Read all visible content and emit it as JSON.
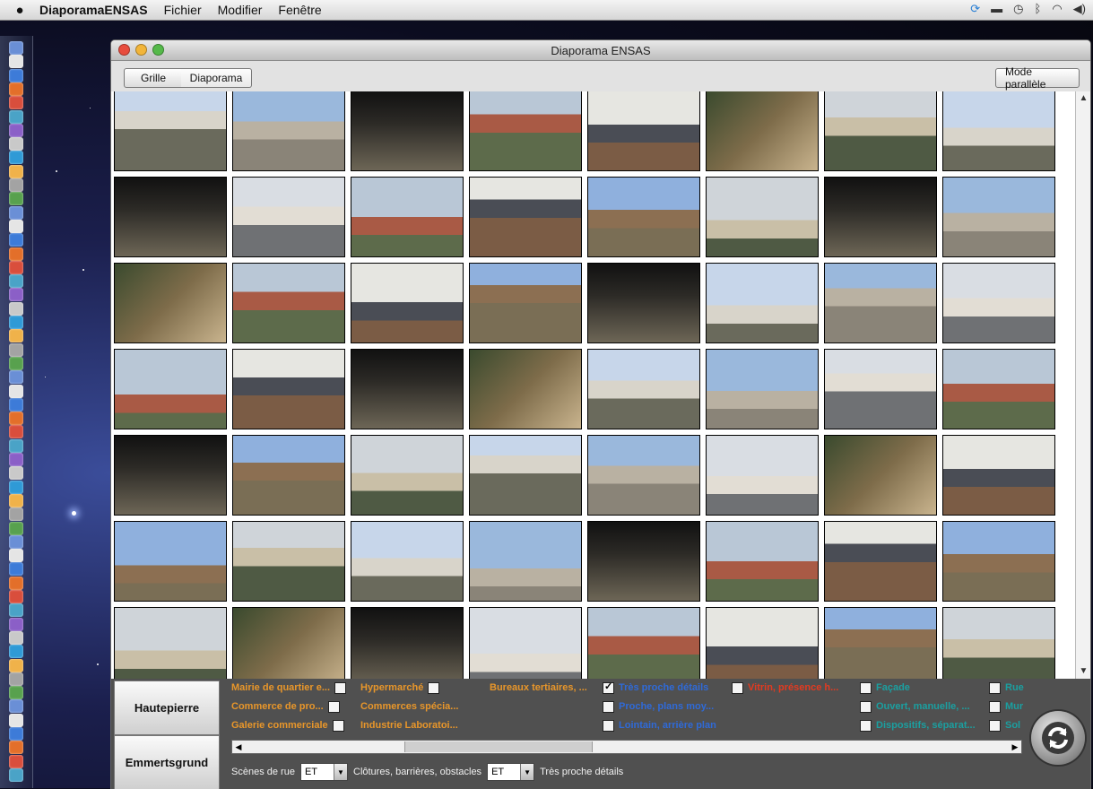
{
  "menubar": {
    "app_name": "DiaporamaENSAS",
    "items": [
      "Fichier",
      "Modifier",
      "Fenêtre"
    ],
    "tray_icons": [
      "sync-icon",
      "display-icon",
      "time-machine-icon",
      "bluetooth-icon",
      "wifi-icon",
      "volume-icon"
    ]
  },
  "window": {
    "title": "Diaporama ENSAS"
  },
  "toolbar": {
    "grid_label": "Grille",
    "slideshow_label": "Diaporama",
    "parallel_label": "Mode parallèle"
  },
  "places": [
    "Hautepierre",
    "Emmertsgrund"
  ],
  "filters": {
    "orange": [
      "Mairie de quartier e...",
      "Hypermarché",
      "Bureaux tertiaires, ...",
      "Commerce de pro...",
      "Commerces spécia...",
      "Galerie commerciale",
      "Industrie Laboratoi..."
    ],
    "blue": [
      "Très proche détails",
      "Proche, plans moy...",
      "Lointain, arrière plan"
    ],
    "red": [
      "Vitrin, présence h..."
    ],
    "teal": [
      "Façade",
      "Ouvert, manuelle, ...",
      "Dispositifs, séparat...",
      "Rue",
      "Mur",
      "Sol"
    ],
    "checked": "Très proche détails"
  },
  "query": {
    "term1": "Scènes de rue",
    "op1": "ET",
    "term2": "Clôtures, barrières, obstacles",
    "op2": "ET",
    "term3": "Très proche détails"
  },
  "colors": {
    "orange": "#e8962a",
    "blue": "#2f6ad8",
    "red": "#e23a20",
    "teal": "#1b9fa0"
  }
}
